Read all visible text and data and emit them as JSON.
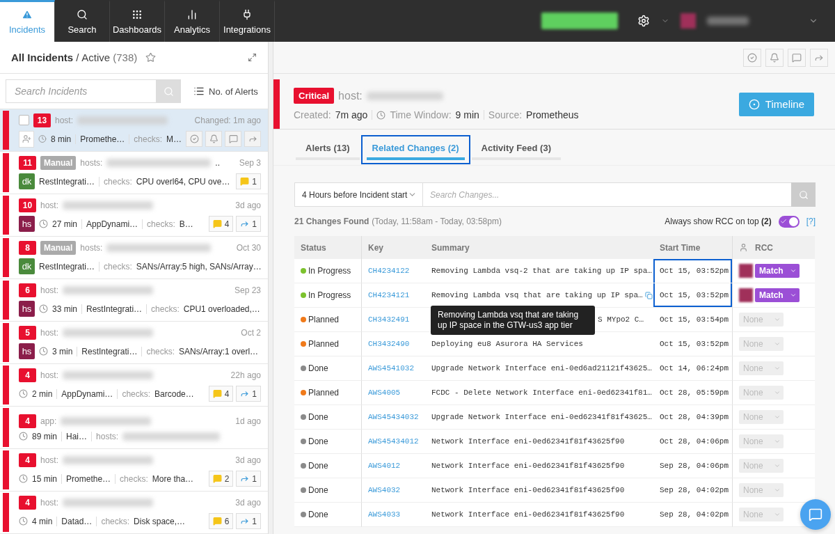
{
  "nav": {
    "tabs": [
      {
        "label": "Incidents",
        "selected": true
      },
      {
        "label": "Search",
        "selected": false
      },
      {
        "label": "Dashboards",
        "selected": false
      },
      {
        "label": "Analytics",
        "selected": false
      },
      {
        "label": "Integrations",
        "selected": false
      }
    ]
  },
  "left": {
    "title": "All Incidents",
    "separator": "/",
    "filter": "Active",
    "count": "(738)",
    "search_placeholder": "Search Incidents",
    "sort_label": "No. of Alerts",
    "incidents": [
      {
        "count": "13",
        "selected": true,
        "target_label": "host:",
        "time": "Changed: 1m ago",
        "assign": true,
        "duration": "8 min",
        "source": "Promethe…",
        "checks_label": "checks:",
        "checks": "M…"
      },
      {
        "count": "11",
        "selected": false,
        "tag": "Manual",
        "target_label": "hosts:",
        "target_suffix": "..",
        "time": "Sep 3",
        "avatar": {
          "initials": "dk",
          "color": "#4a8a3c"
        },
        "source": "RestIntegrati…",
        "checks_label": "checks:",
        "checks": "CPU overl64, CPU ove…",
        "comments": "1"
      },
      {
        "count": "10",
        "selected": false,
        "target_label": "host:",
        "time": "3d ago",
        "avatar": {
          "initials": "hs",
          "color": "#8b1e4a"
        },
        "duration": "27 min",
        "source": "AppDynami…",
        "checks_label": "checks:",
        "checks": "B…",
        "comments": "4",
        "shares": "1"
      },
      {
        "count": "8",
        "selected": false,
        "tag": "Manual",
        "target_label": "hosts:",
        "time": "Oct 30",
        "avatar": {
          "initials": "dk",
          "color": "#4a8a3c"
        },
        "source": "RestIntegrati…",
        "checks_label": "checks:",
        "checks": "SANs/Array:5 high, SANs/Array…"
      },
      {
        "count": "6",
        "selected": false,
        "target_label": "host:",
        "time": "Sep 23",
        "avatar": {
          "initials": "hs",
          "color": "#8b1e4a"
        },
        "duration": "33 min",
        "source": "RestIntegrati…",
        "checks_label": "checks:",
        "checks": "CPU1 overloaded,…"
      },
      {
        "count": "5",
        "selected": false,
        "target_label": "host:",
        "time": "Oct 2",
        "avatar": {
          "initials": "hs",
          "color": "#8b1e4a"
        },
        "duration": "3 min",
        "source": "RestIntegrati…",
        "checks_label": "checks:",
        "checks": "SANs/Array:1 overl…"
      },
      {
        "count": "4",
        "selected": false,
        "target_label": "host:",
        "time": "22h ago",
        "duration": "2 min",
        "source": "AppDynami…",
        "checks_label": "checks:",
        "checks": "Barcode…",
        "comments": "4",
        "shares": "1"
      },
      {
        "count": "4",
        "selected": false,
        "target_label": "app:",
        "time": "1d ago",
        "duration": "89 min",
        "source": "Hai…",
        "checks_label": "hosts:"
      },
      {
        "count": "4",
        "selected": false,
        "target_label": "host:",
        "time": "3d ago",
        "duration": "15 min",
        "source": "Promethe…",
        "checks_label": "checks:",
        "checks": "More tha…",
        "comments": "2",
        "shares": "1"
      },
      {
        "count": "4",
        "selected": false,
        "target_label": "host:",
        "time": "3d ago",
        "duration": "4 min",
        "source": "Datad…",
        "checks_label": "checks:",
        "checks": "Disk space,…",
        "comments": "6",
        "shares": "1"
      }
    ]
  },
  "detail": {
    "severity": "Critical",
    "target_label": "host:",
    "created_label": "Created:",
    "created": "7m ago",
    "window_label": "Time Window:",
    "window": "9 min",
    "source_label": "Source:",
    "source": "Prometheus",
    "timeline_button": "Timeline",
    "tabs": [
      {
        "label": "Alerts (13)",
        "selected": false,
        "highlighted": false
      },
      {
        "label": "Related Changes (2)",
        "selected": true,
        "highlighted": true
      },
      {
        "label": "Activity Feed (3)",
        "selected": false,
        "highlighted": false
      }
    ],
    "range": "4 Hours before Incident start",
    "search_placeholder": "Search Changes...",
    "found": "21 Changes Found",
    "found_range": "(Today, 11:58am - Today, 03:58pm)",
    "rcc_toggle_label": "Always show RCC on top",
    "rcc_toggle_count": "(2)",
    "rcc_toggle_on": true,
    "help": "[?]",
    "columns": [
      "Status",
      "Key",
      "Summary",
      "Start Time",
      "RCC"
    ],
    "tooltip": "Removing Lambda vsq that are taking up IP space in the GTW-us3 app tier",
    "changes": [
      {
        "status": "In Progress",
        "color": "#7cc22e",
        "key": "CH4234122",
        "summary": "Removing Lambda vsq-2 that are taking up IP spa…",
        "start": "Oct 15, 03:52pm",
        "highlighted": true,
        "rcc": "Match",
        "matched": true
      },
      {
        "status": "In Progress",
        "color": "#7cc22e",
        "key": "CH4234121",
        "summary": "Removing Lambda vsq that are taking up IP spa…",
        "copy": true,
        "start": "Oct 15, 03:52pm",
        "highlighted": true,
        "rcc": "Match",
        "matched": true
      },
      {
        "status": "Planned",
        "color": "#f07a1a",
        "key": "CH3432491",
        "summary": "S MYpo2 C…",
        "covered": true,
        "start": "Oct 15, 03:54pm",
        "highlighted": false,
        "rcc": "None",
        "matched": false
      },
      {
        "status": "Planned",
        "color": "#f07a1a",
        "key": "CH3432490",
        "summary": "Deploying eu8 Asurora HA Services",
        "start": "Oct 15, 03:52pm",
        "highlighted": false,
        "rcc": "None",
        "matched": false
      },
      {
        "status": "Done",
        "color": "#8a8a8a",
        "key": "AWS4541032",
        "summary": "Upgrade Network Interface eni-0ed6ad21121f43625…",
        "start": "Oct 14, 06:24pm",
        "highlighted": false,
        "rcc": "None",
        "matched": false
      },
      {
        "status": "Planned",
        "color": "#f07a1a",
        "key": "AWS4005",
        "summary": "FCDC - Delete Network Interface eni-0ed62341f81…",
        "start": "Oct 28, 05:59pm",
        "highlighted": false,
        "rcc": "None",
        "matched": false
      },
      {
        "status": "Done",
        "color": "#8a8a8a",
        "key": "AWS45434032",
        "summary": "Upgrade Network Interface eni-0ed62341f81f43625…",
        "start": "Oct 28, 04:39pm",
        "highlighted": false,
        "rcc": "None",
        "matched": false
      },
      {
        "status": "Done",
        "color": "#8a8a8a",
        "key": "AWS45434012",
        "summary": "Network Interface eni-0ed62341f81f43625f90",
        "start": "Oct 28, 04:06pm",
        "highlighted": false,
        "rcc": "None",
        "matched": false
      },
      {
        "status": "Done",
        "color": "#8a8a8a",
        "key": "AWS4012",
        "summary": "Network Interface eni-0ed62341f81f43625f90",
        "start": "Sep 28, 04:06pm",
        "highlighted": false,
        "rcc": "None",
        "matched": false
      },
      {
        "status": "Done",
        "color": "#8a8a8a",
        "key": "AWS4032",
        "summary": "Network Interface eni-0ed62341f81f43625f90",
        "start": "Sep 28, 04:02pm",
        "highlighted": false,
        "rcc": "None",
        "matched": false
      },
      {
        "status": "Done",
        "color": "#8a8a8a",
        "key": "AWS4033",
        "summary": "Network Interface eni-0ed62341f81f43625f90",
        "start": "Sep 28, 04:02pm",
        "highlighted": false,
        "rcc": "None",
        "matched": false
      }
    ]
  }
}
